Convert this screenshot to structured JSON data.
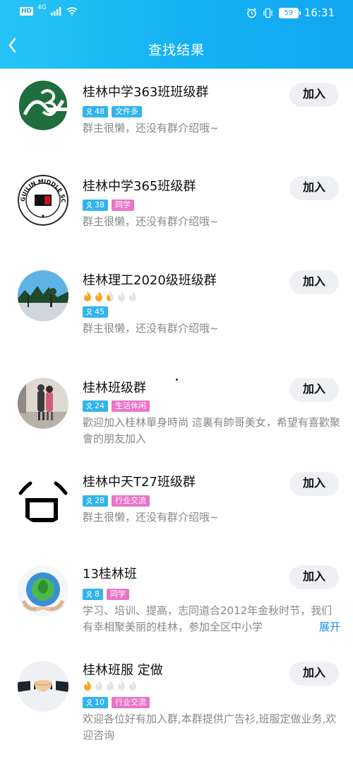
{
  "status_bar": {
    "hd": "HD",
    "network": "4G",
    "battery": "59",
    "time": "16:31"
  },
  "nav": {
    "title": "查找结果"
  },
  "colors": {
    "accent": "#14b1f3",
    "tag_blue": "#32b4ef",
    "tag_pink": "#ea74c8",
    "link": "#1a8ef0"
  },
  "groups": [
    {
      "name": "桂林中学363班班级群",
      "members": "48",
      "category": "文件多",
      "category_color": "blue",
      "level": null,
      "desc": "群主很懒，还没有群介绍哦~",
      "join": "加入",
      "avatar": "school-logo-363"
    },
    {
      "name": "桂林中学365班级群",
      "members": "38",
      "category": "同学",
      "category_color": "pink",
      "level": null,
      "desc": "群主很懒，还没有群介绍哦~",
      "join": "加入",
      "avatar": "guilin-middle-school-logo",
      "avatar_text": "GUILIN MIDDLE SCHOOL"
    },
    {
      "name": "桂林理工2020级班级群",
      "members": "45",
      "category": null,
      "level": 2.5,
      "desc": "群主很懒，还没有群介绍哦~",
      "join": "加入",
      "avatar": "campus-photo"
    },
    {
      "name": "桂林班级群",
      "members": "24",
      "category": "生活休闲",
      "category_color": "pink",
      "level": null,
      "desc": "歡迎加入桂林單身時尚 這裏有帥哥美女，希望有喜歡聚會的朋友加入",
      "join": "加入",
      "avatar": "couple-photo"
    },
    {
      "name": "桂林中天T27班级群",
      "members": "28",
      "category": "行业交流",
      "category_color": "pink",
      "level": null,
      "desc": "群主很懒，还没有群介绍哦~",
      "join": "加入",
      "avatar": "face-emoji"
    },
    {
      "name": "13桂林班",
      "members": "8",
      "category": "同学",
      "category_color": "pink",
      "level": null,
      "desc": "学习、培训、提高，志同道合2012年金秋时节，我们有幸相聚美丽的桂林，参加全区中小学",
      "expand": "展开",
      "join": "加入",
      "avatar": "globe-hands"
    },
    {
      "name": "桂林班服 定做",
      "members": "10",
      "category": "行业交流",
      "category_color": "pink",
      "level": 1,
      "desc": "欢迎各位好有加入群,本群提供广告衫,班服定做业务,欢迎咨询",
      "join": "加入",
      "avatar": "handshake"
    }
  ]
}
